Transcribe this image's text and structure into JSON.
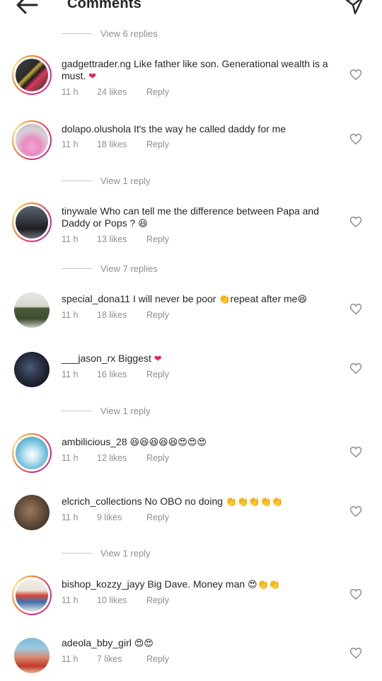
{
  "header": {
    "title": "Comments",
    "back_icon": "arrow-left-icon",
    "send_icon": "paper-plane-icon"
  },
  "view_replies": [
    {
      "label": "View 6 replies"
    },
    {
      "label": "View 1 reply"
    },
    {
      "label": "View 7 replies"
    },
    {
      "label": "View 1 reply"
    },
    {
      "label": "View 1 reply"
    }
  ],
  "comments": [
    {
      "username": "gadgettrader.ng",
      "text": "Like father like son. Generational wealth is a must.",
      "emoji": "❤",
      "time": "11 h",
      "likes": "24 likes",
      "reply": "Reply"
    },
    {
      "username": "dolapo.olushola",
      "text": "It's the way he called daddy for me",
      "emoji": "",
      "time": "11 h",
      "likes": "18 likes",
      "reply": "Reply"
    },
    {
      "username": "tinywale",
      "text": "Who can tell me the difference between Papa and Daddy or Pops ?",
      "emoji": "😆",
      "time": "11 h",
      "likes": "13 likes",
      "reply": "Reply"
    },
    {
      "username": "special_dona11",
      "text": "I will never be poor",
      "emoji": "👏",
      "text2": "repeat after me",
      "emoji2": "😆",
      "time": "11 h",
      "likes": "18 likes",
      "reply": "Reply"
    },
    {
      "username": "___jason_rx",
      "text": "Biggest",
      "emoji": "❤",
      "time": "11 h",
      "likes": "16 likes",
      "reply": "Reply"
    },
    {
      "username": "ambilicious_28",
      "text": "",
      "emoji": "😆😆😆😆😆😍😍😍",
      "time": "11 h",
      "likes": "12 likes",
      "reply": "Reply"
    },
    {
      "username": "elcrich_collections",
      "text": "No OBO no doing",
      "emoji": "👏👏👏👏👏",
      "time": "11 h",
      "likes": "9 likes",
      "reply": "Reply"
    },
    {
      "username": "bishop_kozzy_jayy",
      "text": "Big Dave. Money man",
      "emoji": "😍👏👏",
      "time": "11 h",
      "likes": "10 likes",
      "reply": "Reply"
    },
    {
      "username": "adeola_bby_girl",
      "text": "",
      "emoji": "😍😍",
      "time": "11 h",
      "likes": "7 likes",
      "reply": "Reply"
    }
  ]
}
